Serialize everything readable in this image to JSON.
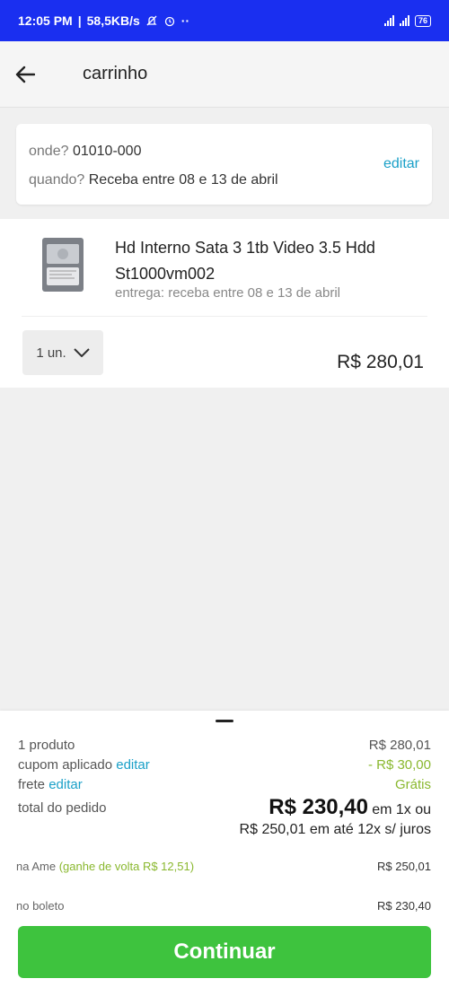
{
  "status_bar": {
    "time": "12:05 PM",
    "network_speed": "58,5KB/s",
    "battery": "76"
  },
  "header": {
    "title": "carrinho"
  },
  "location": {
    "where_label": "onde?",
    "where_value": "01010-000",
    "when_label": "quando?",
    "when_value": "Receba entre 08 e 13 de abril",
    "edit_label": "editar"
  },
  "product": {
    "title": "Hd Interno Sata 3 1tb Video 3.5 Hdd St1000vm002",
    "delivery": "entrega: receba entre 08 e 13 de abril",
    "quantity": "1 un.",
    "price": "R$ 280,01"
  },
  "summary": {
    "products_label": "1 produto",
    "products_value": "R$ 280,01",
    "coupon_label": "cupom aplicado",
    "coupon_edit": "editar",
    "coupon_value": "- R$ 30,00",
    "shipping_label": "frete",
    "shipping_edit": "editar",
    "shipping_value": "Grátis",
    "total_label": "total do pedido",
    "total_value": "R$ 230,40",
    "total_suffix": "em 1x ou",
    "installments": "R$ 250,01 em até 12x s/ juros",
    "ame_label": "na Ame",
    "ame_cashback": "(ganhe de volta R$ 12,51)",
    "ame_value": "R$ 250,01",
    "boleto_label": "no boleto",
    "boleto_value": "R$ 230,40",
    "cta_label": "Continuar"
  },
  "colors": {
    "status_bar": "#1a2ff0",
    "link": "#1aa0c8",
    "discount": "#8ab82f",
    "cta": "#3ec33e"
  }
}
